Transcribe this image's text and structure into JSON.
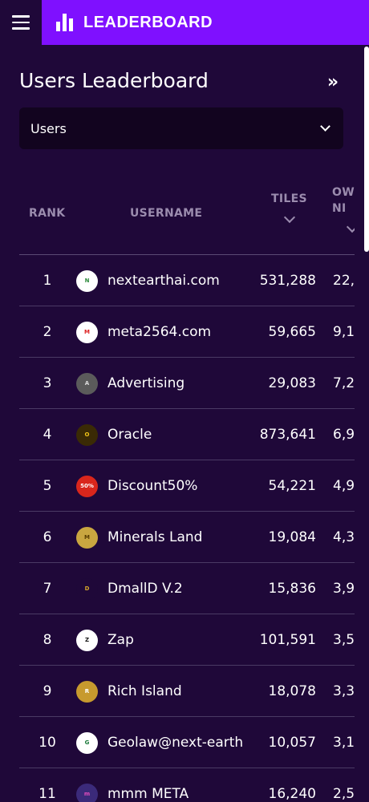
{
  "header": {
    "title": "LEADERBOARD",
    "menu_icon": "hamburger-menu-icon",
    "brand_icon": "bar-chart-icon",
    "brand_color": "#7f10ff"
  },
  "page": {
    "title": "Users Leaderboard",
    "collapse_icon": "double-chevron-right-icon",
    "collapse_glyph": "»"
  },
  "filter": {
    "selected": "Users"
  },
  "table": {
    "columns": {
      "rank": "RANK",
      "username": "USERNAME",
      "tiles": "TILES",
      "owned": "OWNED NI"
    },
    "rows": [
      {
        "rank": "1",
        "username": "nextearthai.com",
        "tiles": "531,288",
        "owned": "22,",
        "avatar": {
          "bg": "#ffffff",
          "fg": "#2e8b3d",
          "text": "N"
        }
      },
      {
        "rank": "2",
        "username": "meta2564.com",
        "tiles": "59,665",
        "owned": "9,1",
        "avatar": {
          "bg": "#ffffff",
          "fg": "#d22",
          "text": "M"
        }
      },
      {
        "rank": "3",
        "username": "Advertising",
        "tiles": "29,083",
        "owned": "7,2",
        "avatar": {
          "bg": "#5b5b5b",
          "fg": "#ddd",
          "text": "A"
        }
      },
      {
        "rank": "4",
        "username": "Oracle",
        "tiles": "873,641",
        "owned": "6,9",
        "avatar": {
          "bg": "#3a2a05",
          "fg": "#f0c419",
          "text": "O"
        }
      },
      {
        "rank": "5",
        "username": "Discount50%",
        "tiles": "54,221",
        "owned": "4,9",
        "avatar": {
          "bg": "#d9261c",
          "fg": "#fff",
          "text": "50%"
        }
      },
      {
        "rank": "6",
        "username": "Minerals Land",
        "tiles": "19,084",
        "owned": "4,3",
        "avatar": {
          "bg": "#c9a640",
          "fg": "#5a3d00",
          "text": "M"
        }
      },
      {
        "rank": "7",
        "username": "DmallD V.2",
        "tiles": "15,836",
        "owned": "3,9",
        "avatar": {
          "bg": "#1f0839",
          "fg": "#d4a52b",
          "text": "D"
        }
      },
      {
        "rank": "8",
        "username": "Zap",
        "tiles": "101,591",
        "owned": "3,5",
        "avatar": {
          "bg": "#ffffff",
          "fg": "#111",
          "text": "Z"
        }
      },
      {
        "rank": "9",
        "username": "Rich Island",
        "tiles": "18,078",
        "owned": "3,3",
        "avatar": {
          "bg": "#c79a2e",
          "fg": "#fff",
          "text": "R"
        }
      },
      {
        "rank": "10",
        "username": "Geolaw@next-earth",
        "tiles": "10,057",
        "owned": "3,1",
        "avatar": {
          "bg": "#ffffff",
          "fg": "#1b7a3a",
          "text": "G"
        }
      },
      {
        "rank": "11",
        "username": "mmm META",
        "tiles": "16,240",
        "owned": "2,5",
        "avatar": {
          "bg": "#3b2a7a",
          "fg": "#e24dbd",
          "text": "m"
        }
      }
    ]
  }
}
